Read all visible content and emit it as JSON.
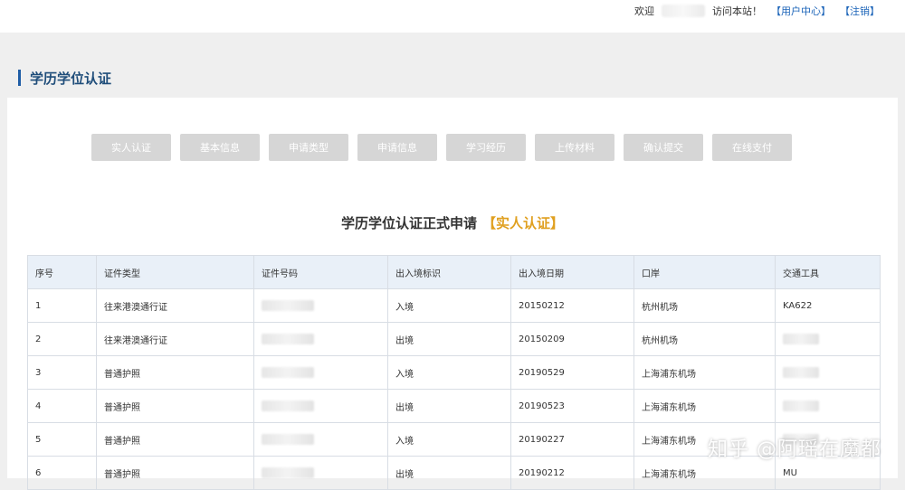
{
  "topbar": {
    "welcome": "欢迎",
    "name_suffix": "访问本站！",
    "user_center": "【用户中心】",
    "logout": "【注销】"
  },
  "section": {
    "title": "学历学位认证"
  },
  "steps": [
    "实人认证",
    "基本信息",
    "申请类型",
    "申请信息",
    "学习经历",
    "上传材料",
    "确认提交",
    "在线支付"
  ],
  "heading": {
    "text": "学历学位认证正式申请",
    "tag": "【实人认证】"
  },
  "table": {
    "columns": [
      "序号",
      "证件类型",
      "证件号码",
      "出入境标识",
      "出入境日期",
      "口岸",
      "交通工具"
    ],
    "rows": [
      {
        "no": "1",
        "doc_type": "往来港澳通行证",
        "doc_no": "",
        "flag": "入境",
        "date": "20150212",
        "port": "杭州机场",
        "vehicle": "KA622"
      },
      {
        "no": "2",
        "doc_type": "往来港澳通行证",
        "doc_no": "",
        "flag": "出境",
        "date": "20150209",
        "port": "杭州机场",
        "vehicle": ""
      },
      {
        "no": "3",
        "doc_type": "普通护照",
        "doc_no": "",
        "flag": "入境",
        "date": "20190529",
        "port": "上海浦东机场",
        "vehicle": ""
      },
      {
        "no": "4",
        "doc_type": "普通护照",
        "doc_no": "",
        "flag": "出境",
        "date": "20190523",
        "port": "上海浦东机场",
        "vehicle": ""
      },
      {
        "no": "5",
        "doc_type": "普通护照",
        "doc_no": "",
        "flag": "入境",
        "date": "20190227",
        "port": "上海浦东机场",
        "vehicle": ""
      },
      {
        "no": "6",
        "doc_type": "普通护照",
        "doc_no": "",
        "flag": "出境",
        "date": "20190212",
        "port": "上海浦东机场",
        "vehicle": "MU"
      }
    ]
  },
  "watermark": "知乎 @阿瑶在魔都"
}
